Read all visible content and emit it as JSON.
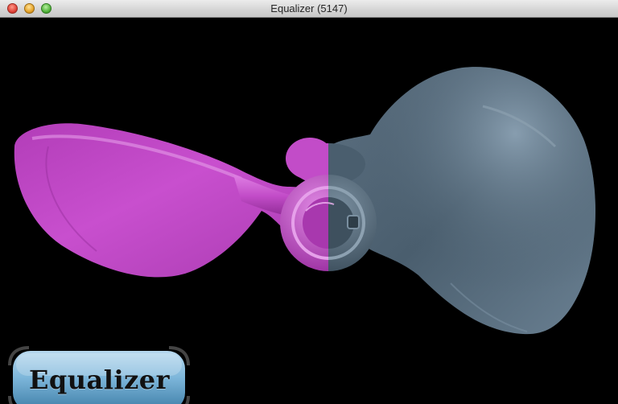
{
  "window": {
    "title": "Equalizer (5147)"
  },
  "logo": {
    "text": "Equalizer"
  },
  "colors": {
    "left_blade": "#c24cc8",
    "right_blade": "#4a5e6e",
    "logo_blue": "#6aa6cc",
    "background": "#000000"
  },
  "icons": {
    "close": "close-icon",
    "minimize": "minimize-icon",
    "zoom": "zoom-icon"
  }
}
